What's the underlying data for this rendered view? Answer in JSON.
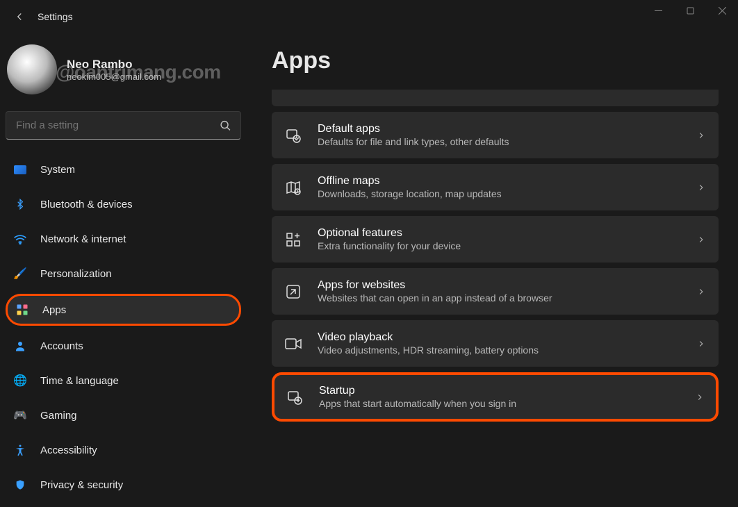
{
  "window": {
    "title": "Settings"
  },
  "user": {
    "name": "Neo Rambo",
    "email": "neokim005@gmail.com",
    "watermark": "@oantrimang.com"
  },
  "search": {
    "placeholder": "Find a setting"
  },
  "sidebar": {
    "items": [
      {
        "label": "System",
        "icon": "system"
      },
      {
        "label": "Bluetooth & devices",
        "icon": "bluetooth"
      },
      {
        "label": "Network & internet",
        "icon": "wifi"
      },
      {
        "label": "Personalization",
        "icon": "brush"
      },
      {
        "label": "Apps",
        "icon": "apps",
        "active": true,
        "highlighted": true
      },
      {
        "label": "Accounts",
        "icon": "person"
      },
      {
        "label": "Time & language",
        "icon": "globe-clock"
      },
      {
        "label": "Gaming",
        "icon": "gamepad"
      },
      {
        "label": "Accessibility",
        "icon": "accessibility"
      },
      {
        "label": "Privacy & security",
        "icon": "shield"
      }
    ]
  },
  "page": {
    "title": "Apps"
  },
  "cards": [
    {
      "title": "Default apps",
      "subtitle": "Defaults for file and link types, other defaults",
      "icon": "default-apps"
    },
    {
      "title": "Offline maps",
      "subtitle": "Downloads, storage location, map updates",
      "icon": "map"
    },
    {
      "title": "Optional features",
      "subtitle": "Extra functionality for your device",
      "icon": "grid-plus"
    },
    {
      "title": "Apps for websites",
      "subtitle": "Websites that can open in an app instead of a browser",
      "icon": "app-link"
    },
    {
      "title": "Video playback",
      "subtitle": "Video adjustments, HDR streaming, battery options",
      "icon": "video"
    },
    {
      "title": "Startup",
      "subtitle": "Apps that start automatically when you sign in",
      "icon": "startup",
      "highlighted": true
    }
  ],
  "colors": {
    "highlight": "#ff4a00",
    "card_bg": "#2b2b2b",
    "bg": "#1a1a1a"
  }
}
